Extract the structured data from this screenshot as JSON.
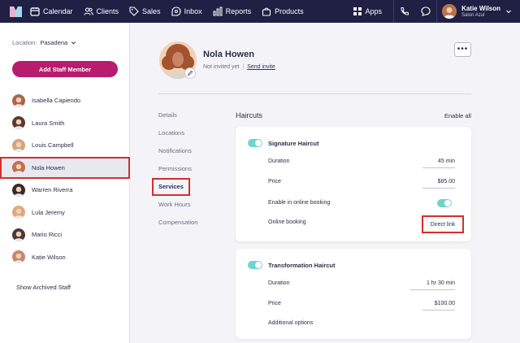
{
  "nav": {
    "items": [
      {
        "label": "Calendar",
        "icon": "calendar-icon"
      },
      {
        "label": "Clients",
        "icon": "users-icon"
      },
      {
        "label": "Sales",
        "icon": "tag-icon"
      },
      {
        "label": "Inbox",
        "icon": "inbox-icon"
      },
      {
        "label": "Reports",
        "icon": "chart-icon"
      },
      {
        "label": "Products",
        "icon": "bag-icon"
      }
    ],
    "apps_label": "Apps",
    "user_name": "Katie Wilson",
    "user_sub": "Salon Azul"
  },
  "sidebar": {
    "location_label": "Location:",
    "location_value": "Pasadena",
    "add_button": "Add Staff Member",
    "staff": [
      {
        "name": "Isabella Capiendo",
        "color": "#a8664a"
      },
      {
        "name": "Laura Smith",
        "color": "#5b3a2e"
      },
      {
        "name": "Louis Campbell",
        "color": "#d8a27e"
      },
      {
        "name": "Nola Howen",
        "color": "#c0704a"
      },
      {
        "name": "Warren Riverra",
        "color": "#3a2a26"
      },
      {
        "name": "Lula Jeremy",
        "color": "#e3a77d"
      },
      {
        "name": "Mario Ricci",
        "color": "#4b3a35"
      },
      {
        "name": "Katie Wilson",
        "color": "#c9876a"
      }
    ],
    "active_index": 3,
    "archived_link": "Show Archived Staff"
  },
  "profile": {
    "name": "Nola Howen",
    "status": "Not invited yet",
    "invite_link": "Send invite",
    "more": "•••"
  },
  "tabs": [
    "Details",
    "Locations",
    "Notifications",
    "Permissions",
    "Services",
    "Work Hours",
    "Compensation"
  ],
  "active_tab": "Services",
  "services": {
    "title": "Haircuts",
    "enable_all": "Enable all",
    "cards": [
      {
        "name": "Signature Haircut",
        "duration_label": "Duration",
        "duration": "45 min",
        "price_label": "Price",
        "price": "$85.00",
        "online_label": "Enable in online booking",
        "booking_label": "Online booking",
        "direct_link": "Direct link"
      },
      {
        "name": "Transformation Haircut",
        "duration_label": "Duration",
        "duration": "1 hr 30 min",
        "price_label": "Price",
        "price": "$100.00",
        "additional": "Additional options"
      }
    ]
  },
  "colors": {
    "nav_bg": "#1f2044",
    "accent": "#b81c6e",
    "toggle_on": "#6fd4cc",
    "highlight": "#d62d2d"
  }
}
